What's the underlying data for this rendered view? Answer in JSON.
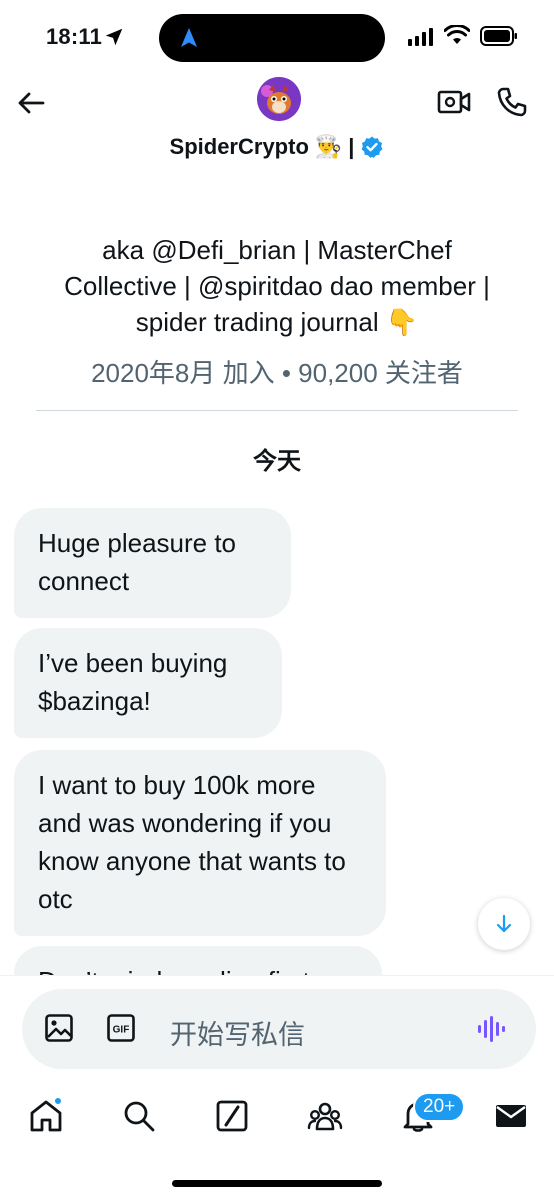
{
  "status_bar": {
    "time": "18:11"
  },
  "header": {
    "name": "SpiderCrypto",
    "name_emoji": "👨‍🍳",
    "name_separator": "|",
    "verified": true,
    "icons": {
      "back": "arrow-left-icon",
      "video": "video-camera-icon",
      "call": "phone-icon"
    }
  },
  "profile": {
    "bio_lines": [
      "aka @Defi_brian | MasterChef",
      "Collective | @spiritdao dao member |",
      "spider trading journal 👇"
    ],
    "meta": "2020年8月 加入 • 90,200 关注者"
  },
  "conversation": {
    "day_label": "今天",
    "messages": [
      {
        "text": "Huge pleasure to connect"
      },
      {
        "text": "I’ve been buying $bazinga!"
      },
      {
        "text": "I want to buy 100k more and was wondering if you know anyone that wants to otc"
      },
      {
        "text": "Don’t mind sending first"
      }
    ]
  },
  "composer": {
    "placeholder": "开始写私信"
  },
  "tabbar": {
    "items": [
      {
        "name": "home",
        "icon": "home-icon",
        "has_dot": true
      },
      {
        "name": "search",
        "icon": "search-icon"
      },
      {
        "name": "grok",
        "icon": "grok-icon"
      },
      {
        "name": "communities",
        "icon": "communities-icon"
      },
      {
        "name": "notifications",
        "icon": "bell-icon",
        "badge": "20+"
      },
      {
        "name": "messages",
        "icon": "envelope-icon"
      }
    ]
  },
  "colors": {
    "accent": "#1d9bf0",
    "bubble": "#eff3f4",
    "secondary_text": "#536471"
  }
}
